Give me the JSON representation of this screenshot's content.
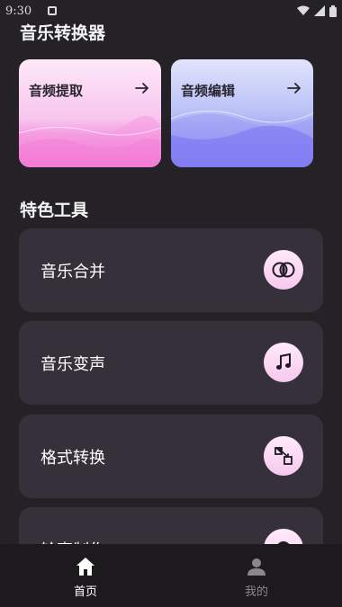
{
  "status_bar": {
    "time": "9:30"
  },
  "app_title": "音乐转换器",
  "feature_cards": [
    {
      "label": "音频提取",
      "icon": "arrow-right-icon"
    },
    {
      "label": "音频编辑",
      "icon": "arrow-right-icon"
    }
  ],
  "section_title": "特色工具",
  "tools": [
    {
      "label": "音乐合并",
      "icon": "merge-circles-icon"
    },
    {
      "label": "音乐变声",
      "icon": "music-note-icon"
    },
    {
      "label": "格式转换",
      "icon": "format-convert-icon"
    },
    {
      "label": "铃声制作",
      "icon": "ringtone-icon"
    }
  ],
  "bottom_nav": [
    {
      "label": "首页",
      "icon": "home-icon",
      "active": true
    },
    {
      "label": "我的",
      "icon": "user-icon",
      "active": false
    }
  ],
  "colors": {
    "background": "#242226",
    "card_background": "#353039",
    "accent_pink": "#ee49c9",
    "accent_purple": "#6b63f3",
    "nav_background": "#1c1a1d"
  }
}
